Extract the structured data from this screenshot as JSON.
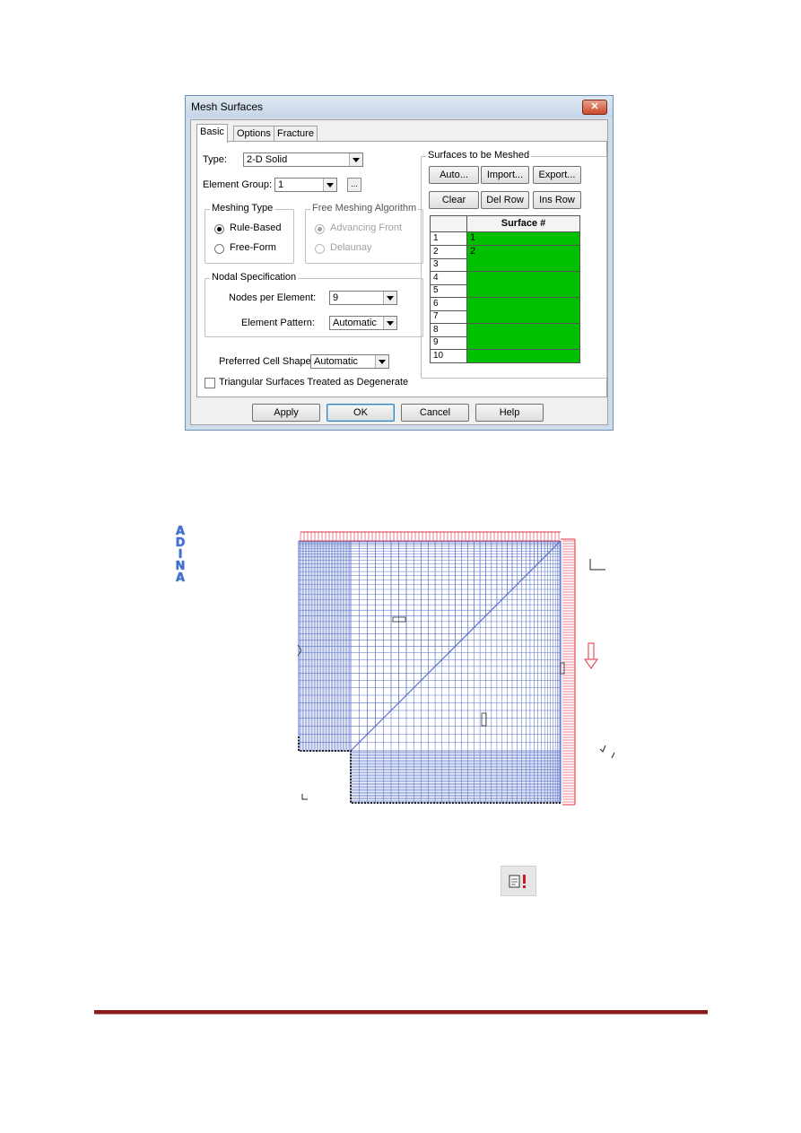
{
  "dialog": {
    "title": "Mesh Surfaces",
    "close_label": "✕",
    "tabs": [
      {
        "label": "Basic",
        "active": true
      },
      {
        "label": "Options",
        "active": false
      },
      {
        "label": "Fracture Options",
        "active": false
      }
    ],
    "type": {
      "label": "Type:",
      "value": "2-D Solid"
    },
    "element_group": {
      "label": "Element Group:",
      "value": "1",
      "more_label": "..."
    },
    "meshing_type": {
      "title": "Meshing Type",
      "options": [
        {
          "label": "Rule-Based",
          "selected": true
        },
        {
          "label": "Free-Form",
          "selected": false
        }
      ]
    },
    "free_meshing": {
      "title": "Free Meshing Algorithm",
      "enabled": false,
      "options": [
        {
          "label": "Advancing Front",
          "selected": true
        },
        {
          "label": "Delaunay",
          "selected": false
        }
      ]
    },
    "nodal_spec": {
      "title": "Nodal Specification",
      "nodes_label": "Nodes per Element:",
      "nodes_value": "9",
      "pattern_label": "Element Pattern:",
      "pattern_value": "Automatic"
    },
    "cell_shape": {
      "label": "Preferred Cell Shape:",
      "value": "Automatic"
    },
    "triangular": {
      "label": "Triangular Surfaces Treated as Degenerate",
      "checked": false
    },
    "surfaces": {
      "title": "Surfaces to be Meshed",
      "buttons": [
        "Auto...",
        "Import...",
        "Export...",
        "Clear",
        "Del Row",
        "Ins Row"
      ],
      "column_header": "Surface #",
      "rows": [
        {
          "num": "1",
          "value": "1"
        },
        {
          "num": "2",
          "value": "2"
        },
        {
          "num": "3",
          "value": ""
        },
        {
          "num": "4",
          "value": ""
        },
        {
          "num": "5",
          "value": ""
        },
        {
          "num": "6",
          "value": ""
        },
        {
          "num": "7",
          "value": ""
        },
        {
          "num": "8",
          "value": ""
        },
        {
          "num": "9",
          "value": ""
        },
        {
          "num": "10",
          "value": ""
        }
      ],
      "cell_color": "#00c000"
    },
    "footer_buttons": [
      "Apply",
      "OK",
      "Cancel",
      "Help"
    ]
  },
  "model": {
    "logo_letters": [
      "A",
      "D",
      "I",
      "N",
      "A"
    ],
    "logo_color": "#3f6fd4",
    "mesh_color": "#5a72c8",
    "load_color": "#e0304a"
  },
  "toolbar": {
    "icon": "generate-mesh-icon"
  },
  "footer_rule_color": "#8b1a1a"
}
